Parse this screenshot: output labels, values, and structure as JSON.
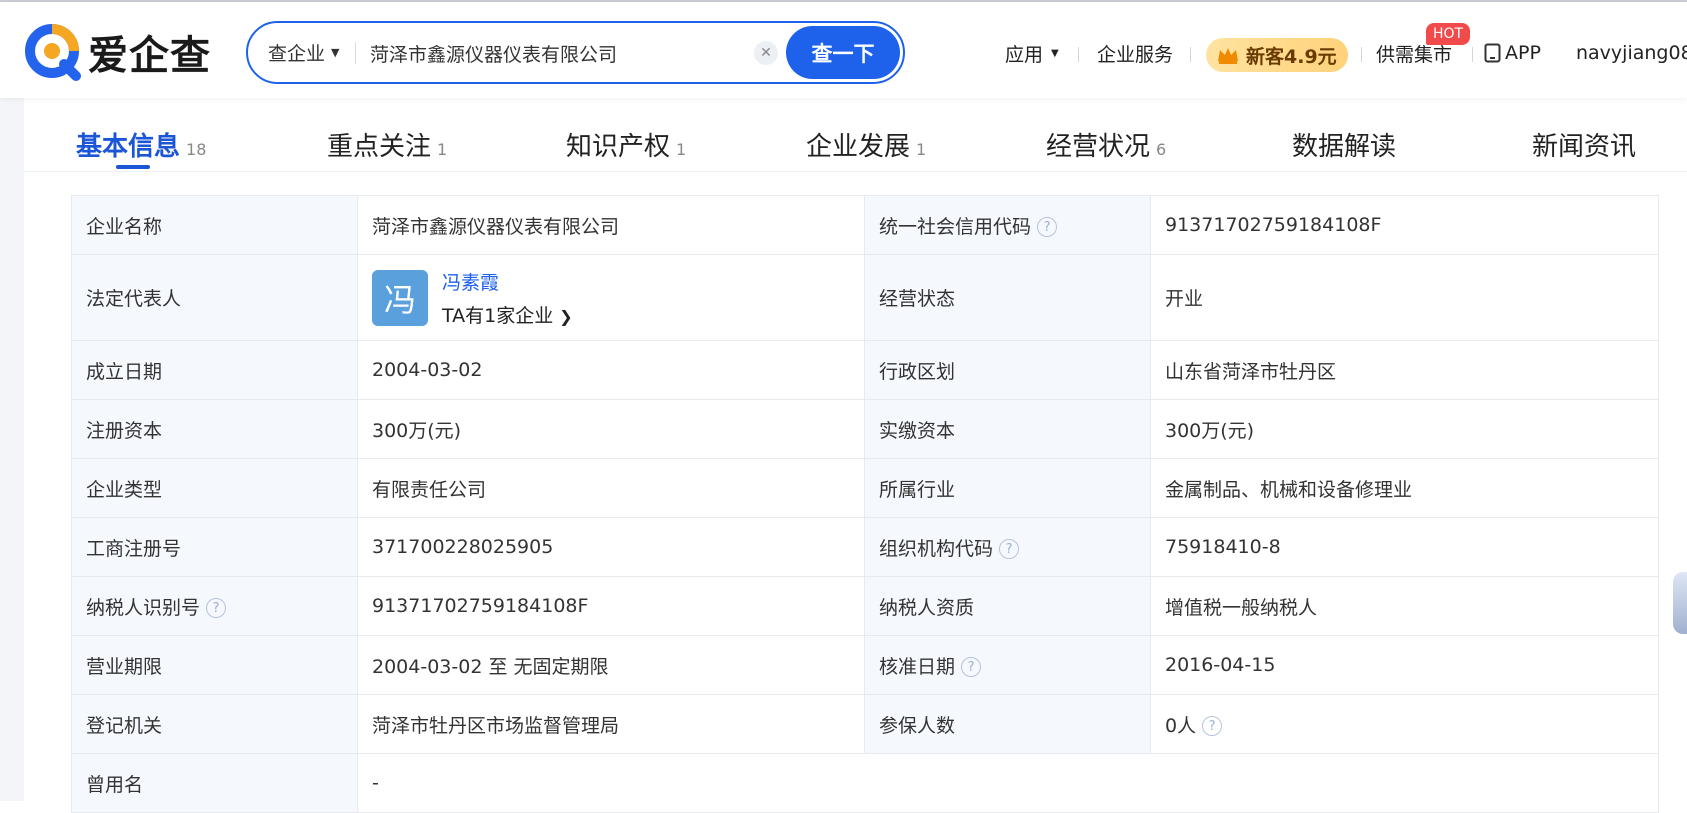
{
  "header": {
    "logo_text": "爱企查",
    "search_type": "查企业",
    "search_value": "菏泽市鑫源仪器仪表有限公司",
    "search_button": "查一下",
    "nav": {
      "apps": "应用",
      "enterprise_services": "企业服务",
      "promo": "新客4.9元",
      "market": "供需集市",
      "hot_badge": "HOT",
      "app": "APP",
      "user": "navyjiang08..."
    }
  },
  "tabs": [
    {
      "label": "基本信息",
      "count": "18"
    },
    {
      "label": "重点关注",
      "count": "1"
    },
    {
      "label": "知识产权",
      "count": "1"
    },
    {
      "label": "企业发展",
      "count": "1"
    },
    {
      "label": "经营状况",
      "count": "6"
    },
    {
      "label": "数据解读",
      "count": ""
    },
    {
      "label": "新闻资讯",
      "count": ""
    }
  ],
  "info": {
    "company_name_label": "企业名称",
    "company_name": "菏泽市鑫源仪器仪表有限公司",
    "credit_code_label": "统一社会信用代码",
    "credit_code": "91371702759184108F",
    "legal_rep_label": "法定代表人",
    "legal_rep_avatar": "冯",
    "legal_rep_name": "冯素霞",
    "legal_rep_companies": "TA有1家企业",
    "status_label": "经营状态",
    "status": "开业",
    "founded_label": "成立日期",
    "founded": "2004-03-02",
    "region_label": "行政区划",
    "region": "山东省菏泽市牡丹区",
    "reg_capital_label": "注册资本",
    "reg_capital": "300万(元)",
    "paid_capital_label": "实缴资本",
    "paid_capital": "300万(元)",
    "type_label": "企业类型",
    "type": "有限责任公司",
    "industry_label": "所属行业",
    "industry": "金属制品、机械和设备修理业",
    "biz_reg_no_label": "工商注册号",
    "biz_reg_no": "371700228025905",
    "org_code_label": "组织机构代码",
    "org_code": "75918410-8",
    "taxpayer_id_label": "纳税人识别号",
    "taxpayer_id": "91371702759184108F",
    "taxpayer_qual_label": "纳税人资质",
    "taxpayer_qual": "增值税一般纳税人",
    "term_label": "营业期限",
    "term": "2004-03-02 至 无固定期限",
    "approved_label": "核准日期",
    "approved": "2016-04-15",
    "authority_label": "登记机关",
    "authority": "菏泽市牡丹区市场监督管理局",
    "insured_label": "参保人数",
    "insured": "0人",
    "former_name_label": "曾用名",
    "former_name": "-"
  },
  "colors": {
    "brand_blue": "#1e62ec",
    "label_bg": "#f5f8fd",
    "hot_red": "#f04a4a"
  }
}
